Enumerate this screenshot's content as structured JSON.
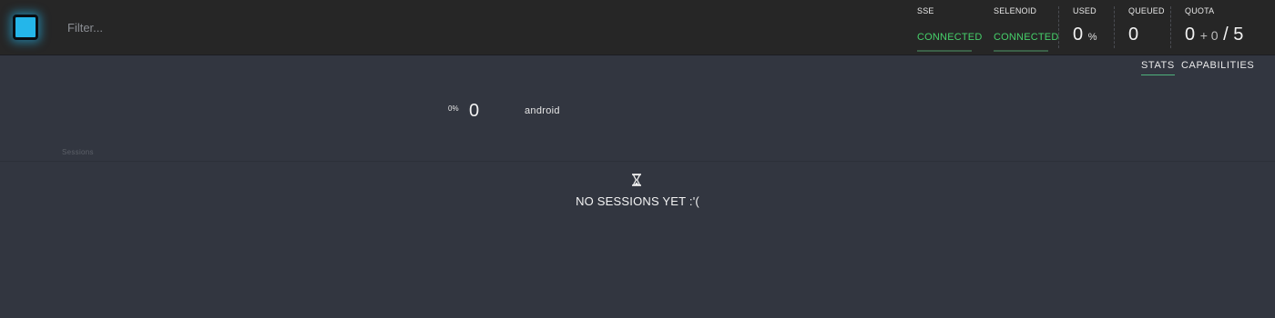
{
  "header": {
    "filter_placeholder": "Filter...",
    "stats": {
      "sse": {
        "label": "SSE",
        "value": "CONNECTED"
      },
      "selenoid": {
        "label": "SELENOID",
        "value": "CONNECTED"
      },
      "used": {
        "label": "USED",
        "value": "0",
        "unit": "%"
      },
      "queued": {
        "label": "QUEUED",
        "value": "0"
      },
      "quota": {
        "label": "QUOTA",
        "value": "0",
        "plus": "+ 0",
        "total": "/ 5"
      }
    },
    "status_color": "#46d06a",
    "logo_color": "#24b6ea"
  },
  "tabs": [
    {
      "label": "STATS",
      "active": true
    },
    {
      "label": "CAPABILITIES",
      "active": false
    }
  ],
  "summary": {
    "percent": "0%",
    "count": "0",
    "browser": "android"
  },
  "sessions": {
    "label": "Sessions",
    "empty_icon": "hourglass-icon",
    "empty_message": "NO SESSIONS YET :'("
  }
}
